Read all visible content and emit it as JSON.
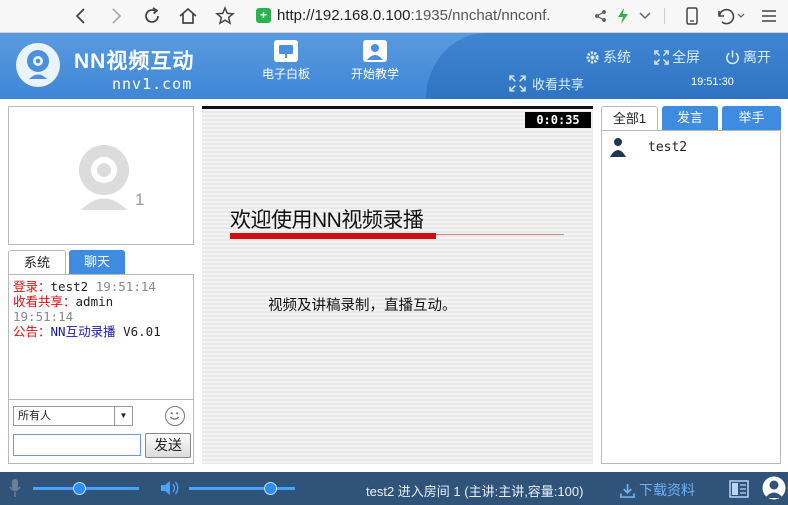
{
  "browser": {
    "url_host": "http://192.168.0.100",
    "url_rest": ":1935/nnchat/nnconf."
  },
  "header": {
    "brand": "NN视频互动",
    "domain": "nnv1.com",
    "whiteboard_label": "电子白板",
    "teaching_label": "开始教学",
    "system_label": "系统",
    "fullscreen_label": "全屏",
    "leave_label": "离开",
    "collect_share_label": "收看共享",
    "time": "19:51:30"
  },
  "video": {
    "seat_number": "1"
  },
  "left_tabs": {
    "system": "系统",
    "chat": "聊天"
  },
  "messages": [
    {
      "label": "登录：",
      "text": "test2",
      "time": "19:51:14"
    },
    {
      "label": "收看共享：",
      "text": "admin",
      "time": "19:51:14"
    },
    {
      "label": "公告：",
      "text": "NN互动录播",
      "version": " V6.01"
    }
  ],
  "chat": {
    "recipient": "所有人",
    "send_label": "发送"
  },
  "slide": {
    "timer": "0:0:35",
    "title": "欢迎使用NN视频录播",
    "body": "视频及讲稿录制，直播互动。"
  },
  "right_tabs": {
    "all": "全部1",
    "speak": "发言",
    "raise_hand": "举手"
  },
  "users": [
    {
      "name": "test2"
    }
  ],
  "footer": {
    "status": "test2 进入房间 1 (主讲:主讲,容量:100)",
    "download_label": "下载资料",
    "mic_level": 0.43,
    "speaker_level": 0.76
  },
  "colors": {
    "header_blue": "#4a90dd",
    "footer_navy": "#30537a",
    "tab_blue": "#3f8be0",
    "slide_red": "#cc1111"
  }
}
